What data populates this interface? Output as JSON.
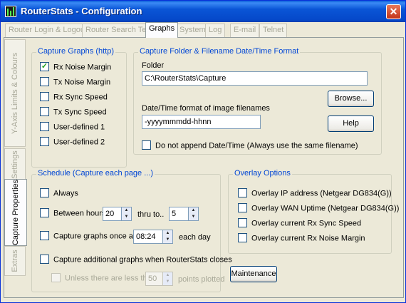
{
  "window": {
    "title": "RouterStats - Configuration",
    "close_symbol": "✕"
  },
  "tabs": [
    {
      "label": "Router Login & Logout",
      "active": false
    },
    {
      "label": "Router Search Text",
      "active": false
    },
    {
      "label": "Graphs",
      "active": true
    },
    {
      "label": "System",
      "active": false
    },
    {
      "label": "Log",
      "active": false
    },
    {
      "label": "E-mail",
      "active": false
    },
    {
      "label": "Telnet",
      "active": false
    }
  ],
  "side_tabs": [
    {
      "label": "Y-Axis Limits & Colours",
      "active": false
    },
    {
      "label": "Common Settings",
      "active": false
    },
    {
      "label": "Capture Properties",
      "active": true
    },
    {
      "label": "Extras",
      "active": false
    }
  ],
  "capture_graphs": {
    "title": "Capture Graphs (http)",
    "items": [
      {
        "label": "Rx Noise Margin",
        "checked": true
      },
      {
        "label": "Tx Noise Margin",
        "checked": false
      },
      {
        "label": "Rx Sync Speed",
        "checked": false
      },
      {
        "label": "Tx Sync Speed",
        "checked": false
      },
      {
        "label": "User-defined 1",
        "checked": false
      },
      {
        "label": "User-defined 2",
        "checked": false
      }
    ]
  },
  "folder_format": {
    "title": "Capture  Folder & Filename Date/Time Format",
    "folder_label": "Folder",
    "folder_value": "C:\\RouterStats\\Capture",
    "browse_label": "Browse...",
    "datetime_label": "Date/Time format of image filenames",
    "datetime_value": "-yyyymmmdd-hhnn",
    "help_label": "Help",
    "no_append_label": "Do not append Date/Time (Always use the same filename)",
    "no_append_checked": false
  },
  "schedule": {
    "title": "Schedule (Capture each page ...)",
    "always_label": "Always",
    "between_label": "Between hours",
    "between_from": "20",
    "thru_label": "thru to..",
    "between_to": "5",
    "once_label": "Capture graphs once at",
    "once_time": "08:24",
    "each_day_label": "each day",
    "additional_label": "Capture additional graphs when RouterStats closes",
    "unless_label": "Unless there are less than",
    "unless_value": "50",
    "points_label": "points  plotted"
  },
  "overlay": {
    "title": "Overlay Options",
    "items": [
      {
        "label": "Overlay IP address (Netgear DG834(G))",
        "checked": false
      },
      {
        "label": "Overlay WAN Uptime (Netgear DG834(G))",
        "checked": false
      },
      {
        "label": "Overlay current Rx Sync Speed",
        "checked": false
      },
      {
        "label": "Overlay current Rx Noise Margin",
        "checked": false
      }
    ]
  },
  "maintenance_label": "Maintenance",
  "colors": {
    "titlebar": "#0a55d6",
    "group_title": "#0046d5",
    "window_bg": "#ece9d8",
    "close": "#d2472a"
  }
}
